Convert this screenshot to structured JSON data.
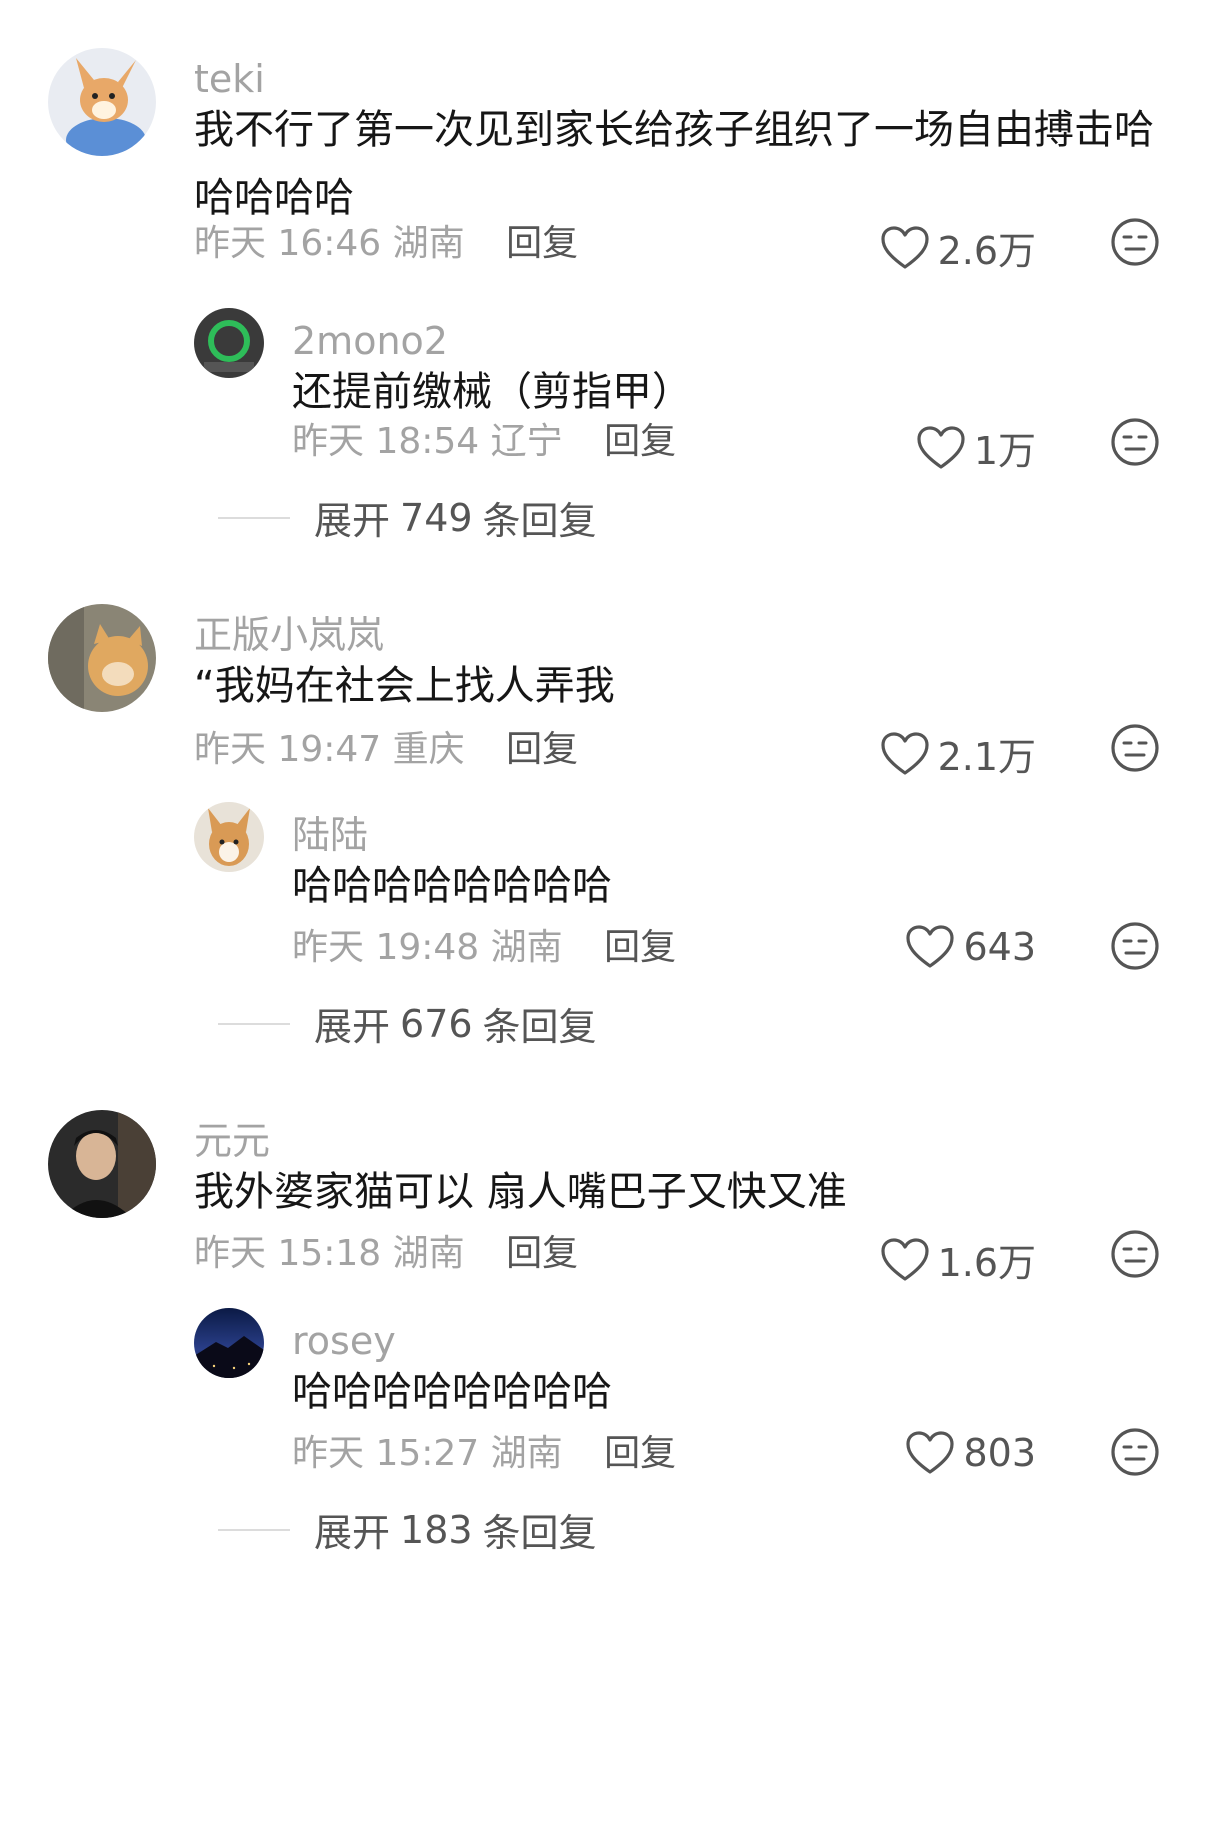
{
  "threads": [
    {
      "top": {
        "username": "teki",
        "text": "我不行了第一次见到家长给孩子组织了一场自由搏击哈哈哈哈哈",
        "time": "昨天 16:46",
        "location": "湖南",
        "reply_label": "回复",
        "likes": "2.6万"
      },
      "reply": {
        "username": "2mono2",
        "text": "还提前缴械（剪指甲）",
        "time": "昨天 18:54",
        "location": "辽宁",
        "reply_label": "回复",
        "likes": "1万"
      },
      "expand": {
        "prefix": "展开",
        "count": "749",
        "suffix": "条回复"
      }
    },
    {
      "top": {
        "username": "正版小岚岚",
        "text": "“我妈在社会上找人弄我",
        "time": "昨天 19:47",
        "location": "重庆",
        "reply_label": "回复",
        "likes": "2.1万"
      },
      "reply": {
        "username": "陆陆",
        "text": "哈哈哈哈哈哈哈哈",
        "time": "昨天 19:48",
        "location": "湖南",
        "reply_label": "回复",
        "likes": "643"
      },
      "expand": {
        "prefix": "展开",
        "count": "676",
        "suffix": "条回复"
      }
    },
    {
      "top": {
        "username": "元元",
        "text": "我外婆家猫可以 扇人嘴巴子又快又准",
        "time": "昨天 15:18",
        "location": "湖南",
        "reply_label": "回复",
        "likes": "1.6万"
      },
      "reply": {
        "username": "rosey",
        "text": "哈哈哈哈哈哈哈哈",
        "time": "昨天 15:27",
        "location": "湖南",
        "reply_label": "回复",
        "likes": "803"
      },
      "expand": {
        "prefix": "展开",
        "count": "183",
        "suffix": "条回复"
      }
    }
  ],
  "icons": {
    "like": "heart-outline-icon",
    "dislike": "meh-face-icon"
  },
  "colors": {
    "username": "#a3a3a3",
    "text": "#161616",
    "meta": "#a3a3a3",
    "action": "#555555"
  }
}
